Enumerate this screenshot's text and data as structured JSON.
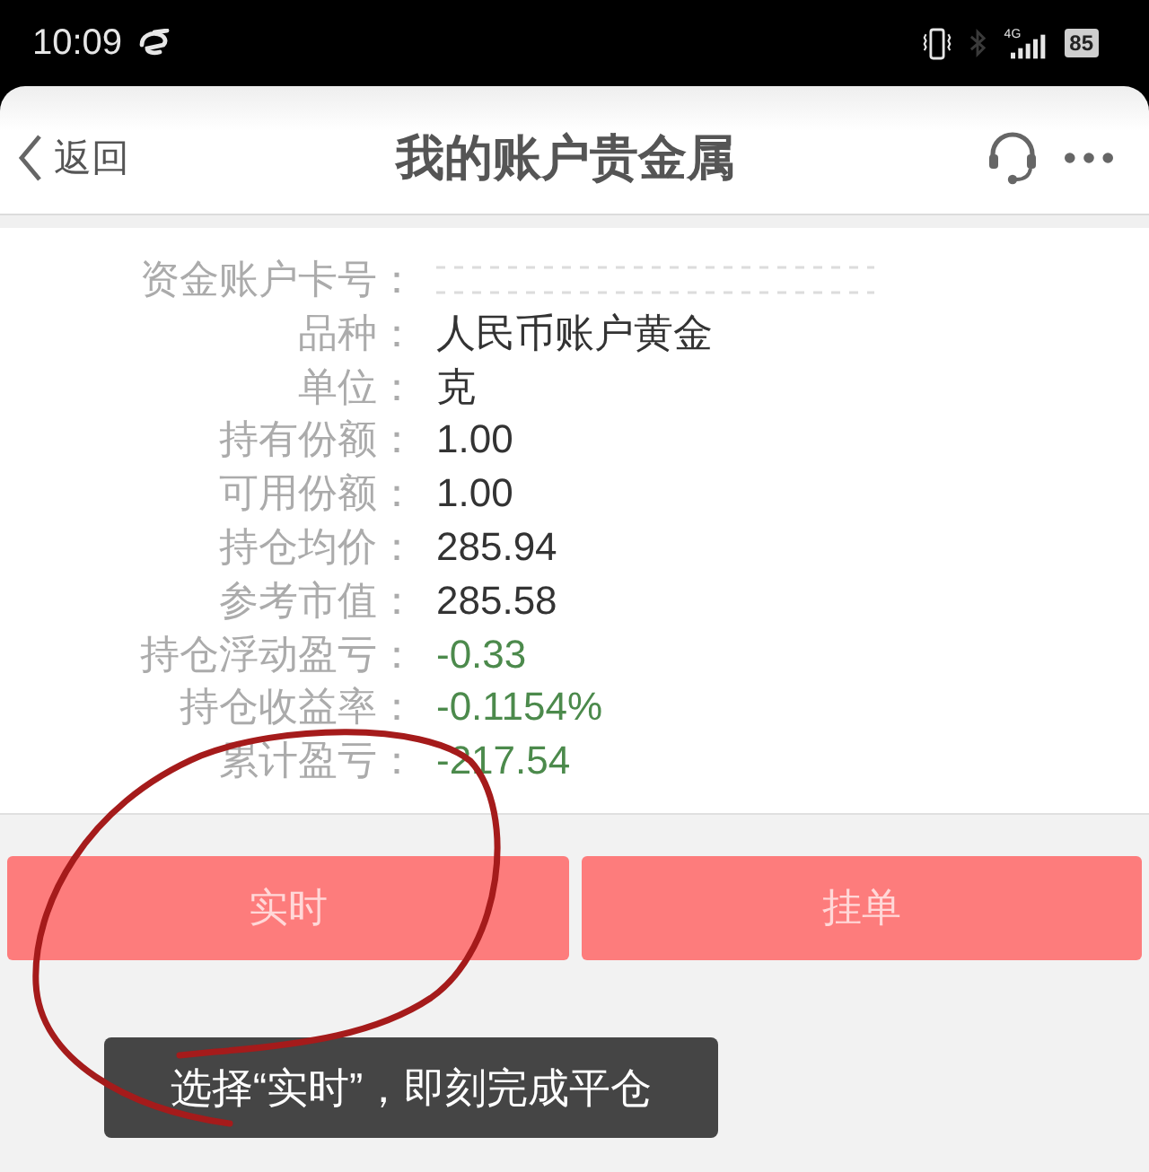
{
  "status_bar": {
    "time": "10:09",
    "network": "4G",
    "battery": "85"
  },
  "header": {
    "back": "返回",
    "title": "我的账户贵金属"
  },
  "fields": [
    {
      "label": "资金账户卡号：",
      "kind": "masked"
    },
    {
      "label": "品种：",
      "value": "人民币账户黄金",
      "kind": "plain"
    },
    {
      "label": "单位：",
      "value": "克",
      "kind": "plain"
    },
    {
      "label": "持有份额：",
      "value": "1.00",
      "kind": "plain"
    },
    {
      "label": "可用份额：",
      "value": "1.00",
      "kind": "plain"
    },
    {
      "label": "持仓均价：",
      "value": "285.94",
      "kind": "plain"
    },
    {
      "label": "参考市值：",
      "value": "285.58",
      "kind": "plain"
    },
    {
      "label": "持仓浮动盈亏：",
      "value": "-0.33",
      "kind": "change"
    },
    {
      "label": "持仓收益率：",
      "value": "-0.1154%",
      "kind": "change"
    },
    {
      "label": "累计盈亏：",
      "value": "-217.54",
      "kind": "change"
    }
  ],
  "buttons": [
    {
      "label": "实时"
    },
    {
      "label": "挂单"
    }
  ],
  "toast": "选择“实时”，即刻完成平仓"
}
